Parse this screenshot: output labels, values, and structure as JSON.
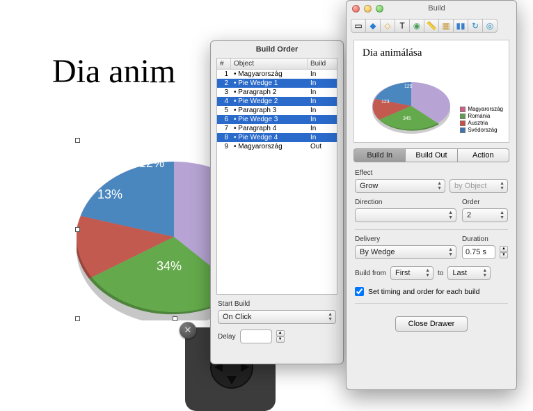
{
  "slide": {
    "title": "Dia anim"
  },
  "order_panel": {
    "title": "Build Order",
    "columns": {
      "num": "#",
      "object": "Object",
      "build": "Build"
    },
    "rows": [
      {
        "num": "1",
        "object": "• Magyarország",
        "build": "In",
        "selected": false
      },
      {
        "num": "2",
        "object": "• Pie Wedge 1",
        "build": "In",
        "selected": true
      },
      {
        "num": "3",
        "object": "• Paragraph 2",
        "build": "In",
        "selected": false
      },
      {
        "num": "4",
        "object": "• Pie Wedge 2",
        "build": "In",
        "selected": true
      },
      {
        "num": "5",
        "object": "• Paragraph 3",
        "build": "In",
        "selected": false
      },
      {
        "num": "6",
        "object": "• Pie Wedge 3",
        "build": "In",
        "selected": true
      },
      {
        "num": "7",
        "object": "• Paragraph 4",
        "build": "In",
        "selected": false
      },
      {
        "num": "8",
        "object": "• Pie Wedge 4",
        "build": "In",
        "selected": true
      },
      {
        "num": "9",
        "object": "• Magyarország",
        "build": "Out",
        "selected": false
      }
    ],
    "start_build_label": "Start Build",
    "start_build_value": "On Click",
    "delay_label": "Delay",
    "delay_value": ""
  },
  "build_panel": {
    "title": "Build",
    "preview_title": "Dia animálása",
    "legend": [
      {
        "label": "Magyarország",
        "color": "#d95b86"
      },
      {
        "label": "Románia",
        "color": "#5aa14a"
      },
      {
        "label": "Ausztria",
        "color": "#d14d44"
      },
      {
        "label": "Svédország",
        "color": "#3a74b4"
      }
    ],
    "tabs": {
      "in": "Build In",
      "out": "Build Out",
      "action": "Action"
    },
    "effect_label": "Effect",
    "effect_value": "Grow",
    "effect_scope": "by Object",
    "direction_label": "Direction",
    "direction_value": "",
    "order_label": "Order",
    "order_value": "2",
    "delivery_label": "Delivery",
    "delivery_value": "By Wedge",
    "duration_label": "Duration",
    "duration_value": "0.75 s",
    "build_from_label": "Build from",
    "build_from_value": "First",
    "build_from_to": "to",
    "build_to_value": "Last",
    "set_timing_label": "Set timing and order for each build",
    "close_label": "Close Drawer"
  },
  "chart_data": {
    "type": "pie",
    "title": "Dia animálása",
    "series": [
      {
        "name": "Magyarország",
        "value": 34,
        "color": "#64aa4c"
      },
      {
        "name": "Románia",
        "value": 13,
        "color": "#c35a4f"
      },
      {
        "name": "Ausztria",
        "value": 12,
        "color": "#4a87bf"
      },
      {
        "name": "Svédország",
        "value": 41,
        "color": "#b59bd0"
      }
    ],
    "labels_shown": [
      "34%",
      "13%",
      "12%"
    ]
  },
  "pie_preview": {
    "labels": {
      "green": "345",
      "red": "123",
      "blue": "125"
    }
  }
}
